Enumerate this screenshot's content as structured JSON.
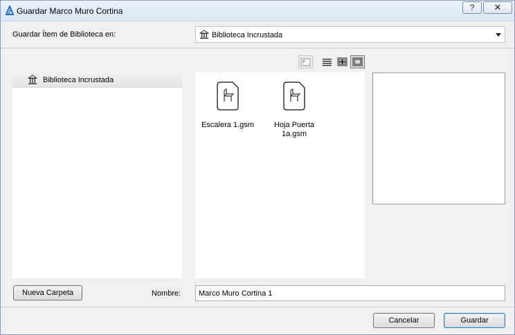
{
  "window": {
    "title": "Guardar Marco Muro Cortina",
    "help_label": "?",
    "close_label": "✕"
  },
  "save_in": {
    "label": "Guardar Ítem de Biblioteca en:",
    "value": "Biblioteca Incrustada"
  },
  "view_modes": [
    "up-folder",
    "list-view",
    "small-icons-view",
    "large-icons-view"
  ],
  "tree": {
    "items": [
      {
        "label": "Biblioteca Incrustada",
        "icon": "library-icon"
      }
    ]
  },
  "files": [
    {
      "name": "Escalera 1.gsm",
      "icon": "chair-file-icon"
    },
    {
      "name": "Hoja Puerta 1a.gsm",
      "icon": "chair-file-icon"
    }
  ],
  "footer": {
    "new_folder_label": "Nueva Carpeta",
    "name_label": "Nombre:",
    "name_value": "Marco Muro Cortina 1",
    "cancel_label": "Cancelar",
    "save_label": "Guardar"
  },
  "colors": {
    "titlebar": "#dbe7f5",
    "default_button_border": "#3c7fb1"
  }
}
